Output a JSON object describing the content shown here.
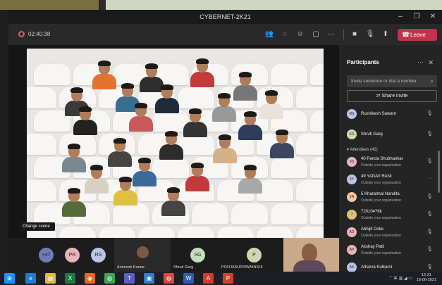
{
  "window": {
    "title": "CYBERNET-2K21",
    "minimize": "–",
    "maximize": "❐",
    "close": "✕"
  },
  "toolbar": {
    "timer": "02:40:38",
    "leave_label": "Leave",
    "icons": [
      "people-icon",
      "chat-icon",
      "reactions-icon",
      "rooms-icon",
      "more-icon",
      "camera-icon",
      "mic-icon",
      "share-icon"
    ]
  },
  "stage": {
    "change_scene": "Change scene"
  },
  "gallery": {
    "bubbles": [
      {
        "initials": "+47",
        "color": "#6c7db8"
      },
      {
        "initials": "PR",
        "color": "#e8b4b8"
      },
      {
        "initials": "RS",
        "color": "#b9c4e6"
      },
      {
        "initials": "SG",
        "color": "#c6dfb8"
      },
      {
        "initials": "P",
        "color": "#c8d9b0"
      }
    ],
    "names": [
      "Animesh Kumar",
      "Shruti Garg",
      "POOJASURYAWANSHI"
    ]
  },
  "panel": {
    "title": "Participants",
    "invite_placeholder": "Invite someone or dial a number",
    "share_invite": "Share invite",
    "presenters": [
      {
        "initials": "RS",
        "name": "Rushikesh Sawant",
        "color": "#b9c4e6"
      },
      {
        "initials": "SG",
        "name": "Shruti Garg",
        "color": "#c6dfb8"
      }
    ],
    "attendees_label": "Attendees (42)",
    "attendees": [
      {
        "initials": "4S",
        "name": "40 Panda Shubhankar",
        "sub": "Outside your organization",
        "color": "#e8b4b8"
      },
      {
        "initials": "4Y",
        "name": "49 YADAV RANI",
        "sub": "Outside your organization",
        "color": "#b9c4e6"
      },
      {
        "initials": "5N",
        "name": "5 Kharatmal Nandita",
        "sub": "Outside your organization",
        "color": "#f0c8a8"
      },
      {
        "initials": "7",
        "name": "720104?6k",
        "sub": "Outside your organization",
        "color": "#d8c47a"
      },
      {
        "initials": "AD",
        "name": "Abhijit Doke",
        "sub": "Outside your organization",
        "color": "#e8b4b8"
      },
      {
        "initials": "AP",
        "name": "Akshay Patil",
        "sub": "Outside your organization",
        "color": "#e8b4b8"
      },
      {
        "initials": "AK",
        "name": "Atharva Kulkarni",
        "sub": "",
        "color": "#b9c4e6"
      }
    ]
  },
  "taskbar": {
    "apps": [
      {
        "icon": "windows-icon",
        "glyph": "⊞",
        "color": "#1e90ff"
      },
      {
        "icon": "edge-icon",
        "glyph": "e",
        "color": "#1c7fd6"
      },
      {
        "icon": "explorer-icon",
        "glyph": "▤",
        "color": "#e0b84a"
      },
      {
        "icon": "excel-icon",
        "glyph": "X",
        "color": "#1f7a44"
      },
      {
        "icon": "firefox-icon",
        "glyph": "◉",
        "color": "#e76a1c"
      },
      {
        "icon": "chrome-icon",
        "glyph": "◍",
        "color": "#3aa655"
      },
      {
        "icon": "teams-icon",
        "glyph": "T",
        "color": "#5b5fc7"
      },
      {
        "icon": "photos-icon",
        "glyph": "▣",
        "color": "#2d7dd2"
      },
      {
        "icon": "chrome2-icon",
        "glyph": "◍",
        "color": "#d94a3d"
      },
      {
        "icon": "word-icon",
        "glyph": "W",
        "color": "#2b5eb8"
      },
      {
        "icon": "pdf-icon",
        "glyph": "A",
        "color": "#d33b2c"
      },
      {
        "icon": "powerpoint-icon",
        "glyph": "P",
        "color": "#c8462b"
      }
    ],
    "time": "12:21",
    "date": "16-06-2021"
  }
}
